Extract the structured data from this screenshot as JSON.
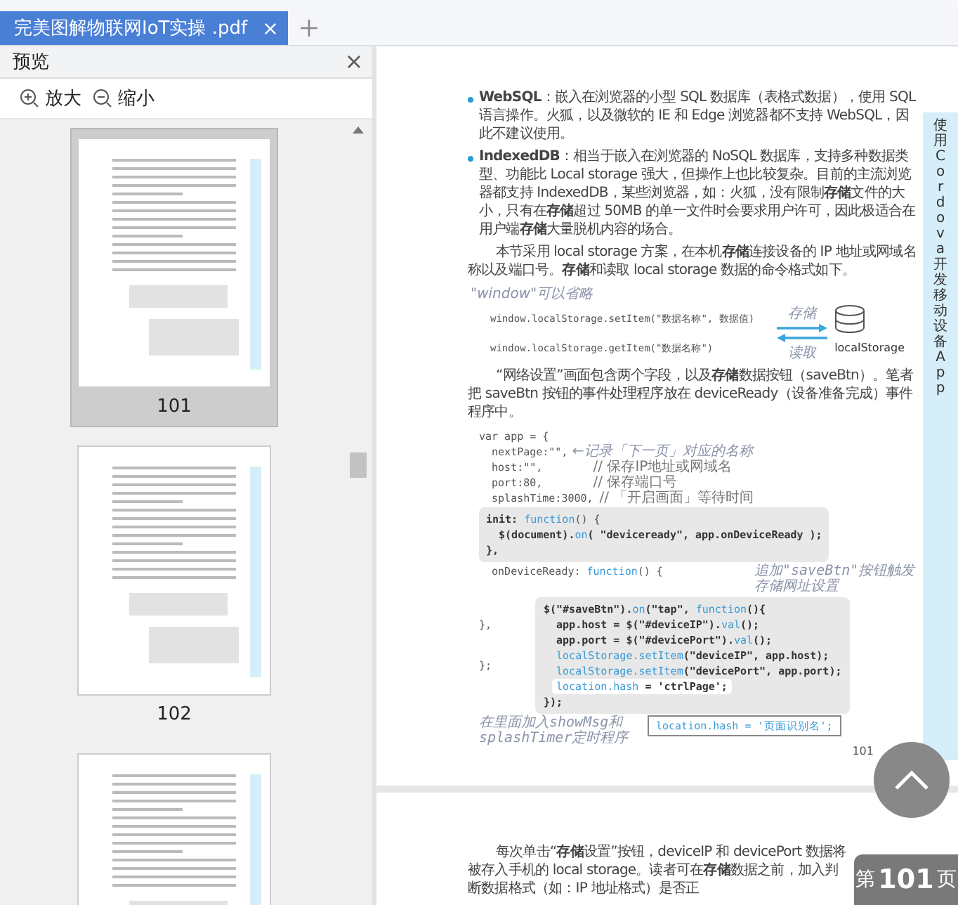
{
  "tab": {
    "title": "完美图解物联网IoT实操 .pdf",
    "selected": true
  },
  "sidebar": {
    "title": "预览",
    "zoom_in": "放大",
    "zoom_out": "缩小",
    "thumbnails": [
      {
        "label": "101",
        "selected": true
      },
      {
        "label": "102",
        "selected": false
      },
      {
        "selected": false
      }
    ]
  },
  "page": {
    "side_tab": "使用Cordova开发移动设备App",
    "bullets": [
      "**WebSQL**：嵌入在浏览器的小型 SQL 数据库（表格式数据），使用 SQL 语言操作。火狐，以及微软的 IE 和 Edge 浏览器都不支持 WebSQL，因此不建议使用。",
      "**IndexedDB**：相当于嵌入在浏览器的 NoSQL 数据库，支持多种数据类型、功能比 Local storage 强大，但操作上也比较复杂。目前的主流浏览器都支持 IndexedDB，某些浏览器，如：火狐，没有限制**存储**文件的大小，只有在**存储**超过 50MB 的单一文件时会要求用户许可，因此极适合在用户端**存储**大量脱机内容的场合。"
    ],
    "intro": "本节采用 local storage 方案，在本机**存储**连接设备的 IP 地址或网域名称以及端口号。**存储**和读取 local storage 数据的命令格式如下。",
    "diagram": {
      "note": "\"window\"可以省略",
      "set_line": "window.localStorage.setItem(\"数据名称\", 数据值)",
      "get_line": "window.localStorage.getItem(\"数据名称\")",
      "set_label": "存储",
      "get_label": "读取",
      "storage_label": "localStorage"
    },
    "para": "“网络设置”画面包含两个字段，以及**存储**数据按钮（saveBtn）。笔者把 saveBtn 按钮的事件处理程序放在 deviceReady（设备准备完成）事件程序中。",
    "code": {
      "top": [
        [
          {
            "t": "var app = {",
            "kind": "plain"
          }
        ],
        [
          {
            "t": "  nextPage:\"\",",
            "kind": "plain"
          },
          {
            "t": " ←记录「下一页」对应的名称",
            "kind": "note"
          }
        ],
        [
          {
            "t": "  host:\"\",        ",
            "kind": "plain"
          },
          {
            "t": "// 保存IP地址或网域名",
            "kind": "comment"
          }
        ],
        [
          {
            "t": "  port:80,        ",
            "kind": "plain"
          },
          {
            "t": "// 保存端口号",
            "kind": "comment"
          }
        ],
        [
          {
            "t": "  splashTime:3000, ",
            "kind": "plain"
          },
          {
            "t": "// 「开启画面」等待时间",
            "kind": "comment"
          }
        ]
      ],
      "init": [
        [
          {
            "t": "init: ",
            "kind": "bold"
          },
          {
            "t": "function",
            "kind": "fn"
          },
          {
            "t": "() {",
            "kind": "plain"
          }
        ],
        [
          {
            "t": "  $(document).",
            "kind": "bold"
          },
          {
            "t": "on",
            "kind": "fn"
          },
          {
            "t": "( \"deviceready\", app.onDeviceReady );",
            "kind": "bold"
          }
        ],
        [
          {
            "t": "},",
            "kind": "bold"
          }
        ]
      ],
      "ready": [
        {
          "t": "  onDeviceReady: ",
          "kind": "plain"
        },
        {
          "t": "function",
          "kind": "fn"
        },
        {
          "t": "() {",
          "kind": "plain"
        }
      ],
      "handler": [
        [
          {
            "t": "$(\"#saveBtn\").",
            "kind": "bold"
          },
          {
            "t": "on",
            "kind": "fn"
          },
          {
            "t": "(\"tap\", ",
            "kind": "bold"
          },
          {
            "t": "function",
            "kind": "fn"
          },
          {
            "t": "(){",
            "kind": "bold"
          }
        ],
        [
          {
            "t": "  app.host = $(\"#deviceIP\").",
            "kind": "bold"
          },
          {
            "t": "val",
            "kind": "fn"
          },
          {
            "t": "();",
            "kind": "bold"
          }
        ],
        [
          {
            "t": "  app.port = $(\"#devicePort\").",
            "kind": "bold"
          },
          {
            "t": "val",
            "kind": "fn"
          },
          {
            "t": "();",
            "kind": "bold"
          }
        ],
        [
          {
            "t": "  localStorage.setItem",
            "kind": "fn"
          },
          {
            "t": "(\"deviceIP\", app.host);",
            "kind": "bold"
          }
        ],
        [
          {
            "t": "  localStorage.setItem",
            "kind": "fn"
          },
          {
            "t": "(\"devicePort\", app.port);",
            "kind": "bold"
          }
        ]
      ],
      "highlight": [
        {
          "t": "location.hash",
          "kind": "fn"
        },
        {
          "t": " = 'ctrlPage';",
          "kind": "bold"
        }
      ],
      "handler_end": "});",
      "close_inner": "},",
      "close_outer": "};",
      "callout": "location.hash = '页面识别名';",
      "side_note": "追加\"saveBtn\"按钮触发存储网址设置",
      "bottom_note": "在里面加入showMsg和splashTimer定时程序"
    },
    "page_number": "101"
  },
  "page2": {
    "paragraph": "每次单击“**存储**设置”按钮，deviceIP 和 devicePort 数据将被存入手机的 local storage。读者可在**存储**数据之前，加入判断数据格式（如：IP 地址格式）是否正"
  },
  "page_badge": {
    "prefix": "第",
    "number": "101",
    "suffix": "页"
  }
}
